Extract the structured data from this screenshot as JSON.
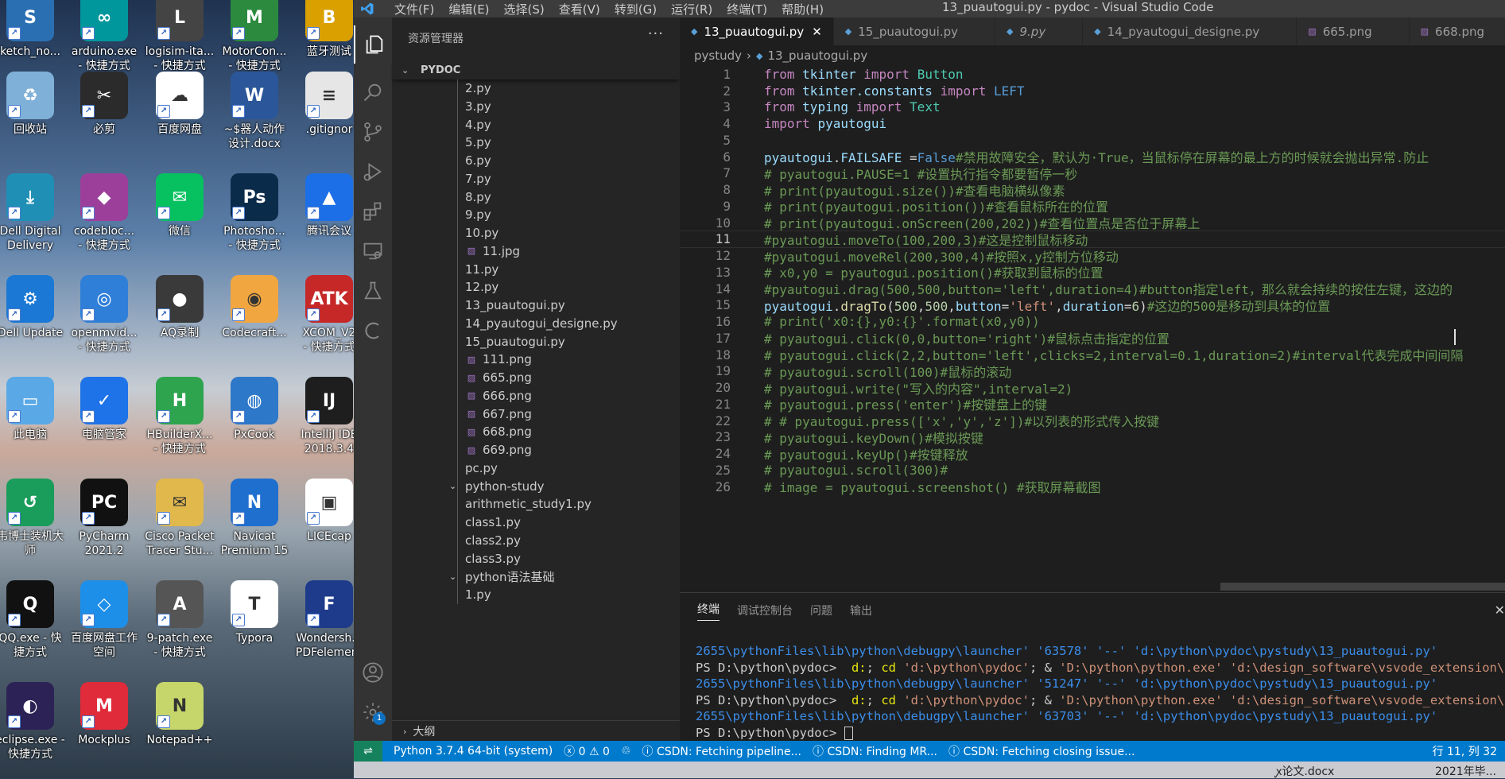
{
  "desktop": {
    "icons": [
      {
        "label": "ketch_no...",
        "color": "#2b6fb3",
        "glyph": "S"
      },
      {
        "label": "arduino.exe\n- 快捷方式",
        "color": "#00979c",
        "glyph": "∞"
      },
      {
        "label": "logisim-ita...\n- 快捷方式",
        "color": "#444444",
        "glyph": "L"
      },
      {
        "label": "MotorCon...\n- 快捷方式",
        "color": "#2b8a3e",
        "glyph": "M"
      },
      {
        "label": "蓝牙测试",
        "color": "#d9a000",
        "glyph": "B"
      },
      {
        "label": "回收站",
        "color": "#7fb0d8",
        "glyph": "♻"
      },
      {
        "label": "必剪",
        "color": "#2b2b2b",
        "glyph": "✂"
      },
      {
        "label": "百度网盘",
        "color": "#ffffff",
        "glyph": "☁"
      },
      {
        "label": "~$器人动作\n设计.docx",
        "color": "#2b579a",
        "glyph": "W"
      },
      {
        "label": ".gitignor",
        "color": "#e6e6e6",
        "glyph": "≡"
      },
      {
        "label": "Dell Digital\nDelivery",
        "color": "#1f8fb5",
        "glyph": "⤓"
      },
      {
        "label": "codebloc...\n- 快捷方式",
        "color": "#9c3f9b",
        "glyph": "◆"
      },
      {
        "label": "微信",
        "color": "#07c160",
        "glyph": "✉"
      },
      {
        "label": "Photosho...\n- 快捷方式",
        "color": "#0b2b4a",
        "glyph": "Ps"
      },
      {
        "label": "腾讯会议",
        "color": "#1c6fe6",
        "glyph": "▲"
      },
      {
        "label": "Dell Update",
        "color": "#1b78d4",
        "glyph": "⚙"
      },
      {
        "label": "openmvid...\n- 快捷方式",
        "color": "#2f7fd8",
        "glyph": "◎"
      },
      {
        "label": "AQ录制",
        "color": "#3a3a3a",
        "glyph": "●"
      },
      {
        "label": "Codecraft...",
        "color": "#f1a640",
        "glyph": "◉"
      },
      {
        "label": "XCOM_V2\n- 快捷方式",
        "color": "#c62828",
        "glyph": "ATK"
      },
      {
        "label": "此电脑",
        "color": "#5aa9e6",
        "glyph": "▭"
      },
      {
        "label": "电脑管家",
        "color": "#1e73e8",
        "glyph": "✓"
      },
      {
        "label": "HBuilderX...\n- 快捷方式",
        "color": "#2ea44f",
        "glyph": "H"
      },
      {
        "label": "PxCook",
        "color": "#2d78c8",
        "glyph": "◍"
      },
      {
        "label": "IntelliJ IDE\n2018.3.4",
        "color": "#1e1e1e",
        "glyph": "IJ"
      },
      {
        "label": "韦博士装机大\n师",
        "color": "#1a9c5a",
        "glyph": "↺"
      },
      {
        "label": "PyCharm\n2021.2",
        "color": "#111111",
        "glyph": "PC"
      },
      {
        "label": "Cisco Packet\nTracer Stu...",
        "color": "#e1b84c",
        "glyph": "✉"
      },
      {
        "label": "Navicat\nPremium 15",
        "color": "#1f6fcf",
        "glyph": "N"
      },
      {
        "label": "LICEcap",
        "color": "#ffffff",
        "glyph": "▣"
      },
      {
        "label": "QQ.exe - 快\n捷方式",
        "color": "#111111",
        "glyph": "Q"
      },
      {
        "label": "百度网盘工作\n空间",
        "color": "#1e8fe8",
        "glyph": "◇"
      },
      {
        "label": "9-patch.exe\n- 快捷方式",
        "color": "#555555",
        "glyph": "A"
      },
      {
        "label": "Typora",
        "color": "#ffffff",
        "glyph": "T"
      },
      {
        "label": "Wondersh...\nPDFelement",
        "color": "#1d3b8a",
        "glyph": "F"
      },
      {
        "label": "eclipse.exe -\n快捷方式",
        "color": "#2c2255",
        "glyph": "◐"
      },
      {
        "label": "Mockplus",
        "color": "#e02b3b",
        "glyph": "M"
      },
      {
        "label": "Notepad++",
        "color": "#c6d66a",
        "glyph": "N"
      }
    ]
  },
  "window": {
    "title": "13_puautogui.py - pydoc - Visual Studio Code",
    "menu": [
      "文件(F)",
      "编辑(E)",
      "选择(S)",
      "查看(V)",
      "转到(G)",
      "运行(R)",
      "终端(T)",
      "帮助(H)"
    ]
  },
  "activity_bar": {
    "settings_badge": "1"
  },
  "sidebar": {
    "header": "资源管理器",
    "more": "···",
    "section": "PYDOC",
    "outline": "大纲",
    "items": [
      {
        "name": "2.py",
        "type": "py",
        "indent": 1
      },
      {
        "name": "3.py",
        "type": "py",
        "indent": 1
      },
      {
        "name": "4.py",
        "type": "py",
        "indent": 1
      },
      {
        "name": "5.py",
        "type": "py",
        "indent": 1
      },
      {
        "name": "6.py",
        "type": "py",
        "indent": 1
      },
      {
        "name": "7.py",
        "type": "py",
        "indent": 1
      },
      {
        "name": "8.py",
        "type": "py",
        "indent": 1
      },
      {
        "name": "9.py",
        "type": "py",
        "indent": 1
      },
      {
        "name": "10.py",
        "type": "py",
        "indent": 1
      },
      {
        "name": "11.jpg",
        "type": "img",
        "indent": 1
      },
      {
        "name": "11.py",
        "type": "py",
        "indent": 1
      },
      {
        "name": "12.py",
        "type": "py",
        "indent": 1
      },
      {
        "name": "13_puautogui.py",
        "type": "py",
        "indent": 1
      },
      {
        "name": "14_pyautogui_designe.py",
        "type": "py",
        "indent": 1
      },
      {
        "name": "15_puautogui.py",
        "type": "py",
        "indent": 1
      },
      {
        "name": "111.png",
        "type": "img",
        "indent": 1
      },
      {
        "name": "665.png",
        "type": "img",
        "indent": 1
      },
      {
        "name": "666.png",
        "type": "img",
        "indent": 1
      },
      {
        "name": "667.png",
        "type": "img",
        "indent": 1
      },
      {
        "name": "668.png",
        "type": "img",
        "indent": 1
      },
      {
        "name": "669.png",
        "type": "img",
        "indent": 1
      },
      {
        "name": "pc.py",
        "type": "py",
        "indent": 1
      },
      {
        "name": "python-study",
        "type": "folder",
        "indent": 0
      },
      {
        "name": "arithmetic_study1.py",
        "type": "py",
        "indent": 1
      },
      {
        "name": "class1.py",
        "type": "py",
        "indent": 1
      },
      {
        "name": "class2.py",
        "type": "py",
        "indent": 1
      },
      {
        "name": "class3.py",
        "type": "py",
        "indent": 1
      },
      {
        "name": "python语法基础",
        "type": "folder",
        "indent": 0
      },
      {
        "name": "1.py",
        "type": "py",
        "indent": 1
      }
    ]
  },
  "tabs": [
    {
      "label": "13_puautogui.py",
      "type": "py",
      "active": true,
      "italic": false,
      "closable": true
    },
    {
      "label": "15_puautogui.py",
      "type": "py",
      "active": false,
      "italic": false,
      "closable": false
    },
    {
      "label": "9.py",
      "type": "py",
      "active": false,
      "italic": true,
      "closable": false
    },
    {
      "label": "14_pyautogui_designe.py",
      "type": "py",
      "active": false,
      "italic": false,
      "closable": false
    },
    {
      "label": "665.png",
      "type": "img",
      "active": false,
      "italic": false,
      "closable": false
    },
    {
      "label": "668.png",
      "type": "img",
      "active": false,
      "italic": false,
      "closable": false
    }
  ],
  "breadcrumb": [
    "pystudy",
    "13_puautogui.py"
  ],
  "editor": {
    "current_line": 11,
    "lines": [
      [
        [
          "kw",
          "from"
        ],
        [
          "op",
          " "
        ],
        [
          "id",
          "tkinter"
        ],
        [
          "op",
          " "
        ],
        [
          "kw",
          "import"
        ],
        [
          "op",
          " "
        ],
        [
          "cls",
          "Button"
        ]
      ],
      [
        [
          "kw",
          "from"
        ],
        [
          "op",
          " "
        ],
        [
          "id",
          "tkinter.constants"
        ],
        [
          "op",
          " "
        ],
        [
          "kw",
          "import"
        ],
        [
          "op",
          " "
        ],
        [
          "bool",
          "LEFT"
        ]
      ],
      [
        [
          "kw",
          "from"
        ],
        [
          "op",
          " "
        ],
        [
          "id",
          "typing"
        ],
        [
          "op",
          " "
        ],
        [
          "kw",
          "import"
        ],
        [
          "op",
          " "
        ],
        [
          "cls",
          "Text"
        ]
      ],
      [
        [
          "kw",
          "import"
        ],
        [
          "op",
          " "
        ],
        [
          "id",
          "pyautogui"
        ]
      ],
      [],
      [
        [
          "id",
          "pyautogui"
        ],
        [
          "op",
          "."
        ],
        [
          "id",
          "FAILSAFE"
        ],
        [
          "op",
          " ="
        ],
        [
          "bool",
          "False"
        ],
        [
          "cm",
          "#禁用故障安全，默认为·True，当鼠标停在屏幕的最上方的时候就会抛出异常.防止"
        ]
      ],
      [
        [
          "cm",
          "# pyautogui.PAUSE=1 #设置执行指令都要暂停一秒"
        ]
      ],
      [
        [
          "cm",
          "# print(pyautogui.size())#查看电脑横纵像素"
        ]
      ],
      [
        [
          "cm",
          "# print(pyautogui.position())#查看鼠标所在的位置"
        ]
      ],
      [
        [
          "cm",
          "# print(pyautogui.onScreen(200,202))#查看位置点是否位于屏幕上"
        ]
      ],
      [
        [
          "cm",
          "#pyautogui.moveTo(100,200,3)#这是控制鼠标移动"
        ]
      ],
      [
        [
          "cm",
          "#pyautogui.moveRel(200,300,4)#按照x,y控制方位移动"
        ]
      ],
      [
        [
          "cm",
          "# x0,y0 = pyautogui.position()#获取到鼠标的位置"
        ]
      ],
      [
        [
          "cm",
          "#pyautogui.drag(500,500,button='left',duration=4)#button指定left，那么就会持续的按住左键，这边的"
        ]
      ],
      [
        [
          "id",
          "pyautogui"
        ],
        [
          "op",
          "."
        ],
        [
          "fn",
          "dragTo"
        ],
        [
          "op",
          "("
        ],
        [
          "num",
          "500"
        ],
        [
          "op",
          ","
        ],
        [
          "num",
          "500"
        ],
        [
          "op",
          ","
        ],
        [
          "id",
          "button"
        ],
        [
          "op",
          "="
        ],
        [
          "str",
          "'left'"
        ],
        [
          "op",
          ","
        ],
        [
          "id",
          "duration"
        ],
        [
          "op",
          "="
        ],
        [
          "num",
          "6"
        ],
        [
          "op",
          ")"
        ],
        [
          "cm",
          "#这边的500是移动到具体的位置"
        ]
      ],
      [
        [
          "cm",
          "# print('x0:{},y0:{}'.format(x0,y0))"
        ]
      ],
      [
        [
          "cm",
          "# pyautogui.click(0,0,button='right')#鼠标点击指定的位置"
        ]
      ],
      [
        [
          "cm",
          "# pyautogui.click(2,2,button='left',clicks=2,interval=0.1,duration=2)#interval代表完成中间间隔"
        ]
      ],
      [
        [
          "cm",
          "# pyautogui.scroll(100)#鼠标的滚动"
        ]
      ],
      [
        [
          "cm",
          "# pyautogui.write(\"写入的内容\",interval=2)"
        ]
      ],
      [
        [
          "cm",
          "# pyautogui.press('enter')#按键盘上的键"
        ]
      ],
      [
        [
          "cm",
          "# # pyautogui.press(['x','y','z'])#以列表的形式传入按键"
        ]
      ],
      [
        [
          "cm",
          "# pyautogui.keyDown()#模拟按键"
        ]
      ],
      [
        [
          "cm",
          "# pyautogui.keyUp()#按键释放"
        ]
      ],
      [
        [
          "cm",
          "# pyautogui.scroll(300)#"
        ]
      ],
      [
        [
          "cm",
          "# image = pyautogui.screenshot() #获取屏幕截图"
        ]
      ]
    ]
  },
  "panel": {
    "tabs": [
      "终端",
      "调试控制台",
      "问题",
      "输出"
    ],
    "close": "✕",
    "terminal": [
      [
        [
          "path",
          "2655\\pythonFiles\\lib\\python\\debugpy\\launcher' '63578' '--' 'd:\\python\\pydoc\\pystudy\\13_puautogui.py'"
        ]
      ],
      [
        [
          "prompt",
          "PS D:\\python\\pydoc> "
        ],
        [
          "cmd",
          " d:"
        ],
        [
          "prompt",
          "; "
        ],
        [
          "cmd",
          "cd"
        ],
        [
          "s",
          " 'd:\\python\\pydoc'"
        ],
        [
          "prompt",
          "; & "
        ],
        [
          "s",
          "'D:\\python\\python.exe' 'd:\\design_software\\vsvode_extension\\ms-p"
        ]
      ],
      [
        [
          "path",
          "2655\\pythonFiles\\lib\\python\\debugpy\\launcher' '51247' '--' 'd:\\python\\pydoc\\pystudy\\13_puautogui.py'"
        ]
      ],
      [
        [
          "prompt",
          "PS D:\\python\\pydoc> "
        ],
        [
          "cmd",
          " d:"
        ],
        [
          "prompt",
          "; "
        ],
        [
          "cmd",
          "cd"
        ],
        [
          "s",
          " 'd:\\python\\pydoc'"
        ],
        [
          "prompt",
          "; & "
        ],
        [
          "s",
          "'D:\\python\\python.exe' 'd:\\design_software\\vsvode_extension\\ms-p"
        ]
      ],
      [
        [
          "path",
          "2655\\pythonFiles\\lib\\python\\debugpy\\launcher' '63703' '--' 'd:\\python\\pydoc\\pystudy\\13_puautogui.py'"
        ]
      ],
      [
        [
          "prompt",
          "PS D:\\python\\pydoc> "
        ]
      ]
    ]
  },
  "statusbar": {
    "python": "Python 3.7.4 64-bit (system)",
    "errors": "0",
    "warnings": "0",
    "items": [
      "CSDN: Fetching pipeline...",
      "CSDN: Finding MR...",
      "CSDN: Fetching closing issue..."
    ],
    "position": "行 11, 列 32"
  },
  "taskstrip": {
    "left": "ꭙ论文.docx",
    "right": "2021年毕..."
  }
}
